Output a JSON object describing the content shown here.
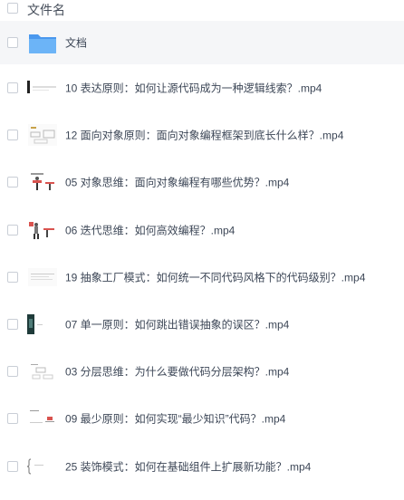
{
  "header": {
    "title": "文件名"
  },
  "folder": {
    "name": "文档"
  },
  "files": [
    {
      "name": "10 表达原则：如何让源代码成为一种逻辑线索？.mp4",
      "thumb": "dark-bar-thumbnail"
    },
    {
      "name": "12 面向对象原则：面向对象编程框架到底长什么样？.mp4",
      "thumb": "diagram-thumbnail"
    },
    {
      "name": "05 对象思维：面向对象编程有哪些优势？.mp4",
      "thumb": "illustration-thumbnail"
    },
    {
      "name": "06 迭代思维：如何高效编程？.mp4",
      "thumb": "illustration-thumbnail"
    },
    {
      "name": "19 抽象工厂模式：如何统一不同代码风格下的代码级别？.mp4",
      "thumb": "text-slide-thumbnail"
    },
    {
      "name": "07 单一原则：如何跳出错误抽象的误区？.mp4",
      "thumb": "dark-photo-thumbnail"
    },
    {
      "name": "03 分层思维：为什么要做代码分层架构？.mp4",
      "thumb": "diagram-thumbnail"
    },
    {
      "name": "09 最少原则：如何实现“最少知识”代码？.mp4",
      "thumb": "slide-thumbnail"
    },
    {
      "name": "25 装饰模式：如何在基础组件上扩展新功能？.mp4",
      "thumb": "bracket-thumbnail"
    }
  ],
  "colors": {
    "folder": "#5aa6f4",
    "text": "#3d4757",
    "row_highlight": "#f5f6f8"
  }
}
